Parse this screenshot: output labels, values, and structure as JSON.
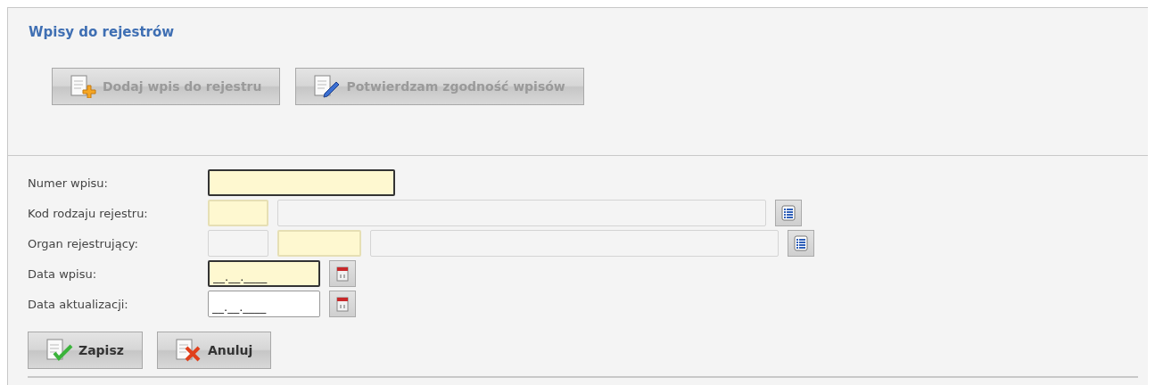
{
  "panel": {
    "title": "Wpisy do rejestrów"
  },
  "toolbar": [
    {
      "label": "Dodaj wpis do rejestru",
      "kind": "add",
      "disabled": true
    },
    {
      "label": "Potwierdzam zgodność wpisów",
      "kind": "edit",
      "disabled": true
    }
  ],
  "form": [
    {
      "label": "Numer wpisu:",
      "kind": "plain",
      "fields": [
        {
          "kind": "text",
          "required": true,
          "focused": true,
          "readonly": false
        }
      ]
    },
    {
      "label": "Kod rodzaju rejestru:",
      "kind": "lookup",
      "fields": [
        {
          "kind": "text",
          "required": true,
          "focused": false,
          "readonly": false
        },
        {
          "kind": "text",
          "required": false,
          "focused": false,
          "readonly": true
        }
      ]
    },
    {
      "label": "Organ rejestrujący:",
      "kind": "lookup",
      "fields": [
        {
          "kind": "text",
          "required": false,
          "focused": false,
          "readonly": true
        },
        {
          "kind": "text",
          "required": true,
          "focused": false,
          "readonly": false
        },
        {
          "kind": "text",
          "required": false,
          "focused": false,
          "readonly": true
        }
      ]
    },
    {
      "label": "Data wpisu:",
      "kind": "date",
      "fields": [
        {
          "kind": "date",
          "required": true,
          "focused": true,
          "readonly": false,
          "value": "__.__.____"
        }
      ]
    },
    {
      "label": "Data aktualizacji:",
      "kind": "date",
      "fields": [
        {
          "kind": "date",
          "required": false,
          "focused": false,
          "readonly": false,
          "value": "__.__.____"
        }
      ]
    }
  ],
  "actions": [
    {
      "label": "Zapisz",
      "kind": "save",
      "disabled": false
    },
    {
      "label": "Anuluj",
      "kind": "cancel",
      "disabled": false
    }
  ]
}
